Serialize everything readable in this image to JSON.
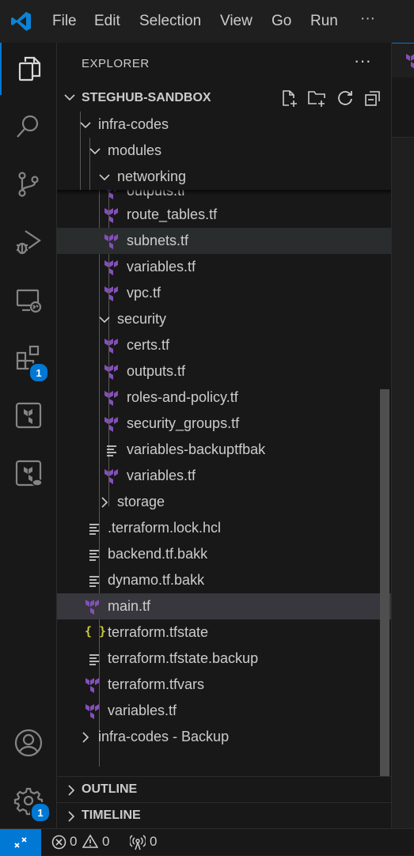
{
  "menu": {
    "file": "File",
    "edit": "Edit",
    "selection": "Selection",
    "view": "View",
    "go": "Go",
    "run": "Run",
    "more": "···"
  },
  "activity_bar": {
    "extensions_badge": "1",
    "accounts_badge": "1"
  },
  "explorer": {
    "title": "EXPLORER",
    "more": "···",
    "root": "STEGHUB-SANDBOX",
    "sticky": {
      "infra_codes": "infra-codes",
      "modules": "modules",
      "networking": "networking"
    },
    "files": {
      "outputs_partial": "outputs.tf",
      "route_tables": "route_tables.tf",
      "subnets": "subnets.tf",
      "variables_net": "variables.tf",
      "vpc": "vpc.tf",
      "security": "security",
      "certs": "certs.tf",
      "outputs_sec": "outputs.tf",
      "roles_policy": "roles-and-policy.tf",
      "security_groups": "security_groups.tf",
      "variables_backup": "variables-backuptfbak",
      "variables_sec": "variables.tf",
      "storage": "storage",
      "lock_hcl": ".terraform.lock.hcl",
      "backend_bakk": "backend.tf.bakk",
      "dynamo_bakk": "dynamo.tf.bakk",
      "main": "main.tf",
      "tfstate": "terraform.tfstate",
      "tfstate_backup": "terraform.tfstate.backup",
      "tfvars": "terraform.tfvars",
      "variables_root": "variables.tf",
      "infra_backup": "infra-codes - Backup"
    },
    "json_icon_glyph": "{ }"
  },
  "panels": {
    "outline": "OUTLINE",
    "timeline": "TIMELINE"
  },
  "status": {
    "errors": "0",
    "warnings": "0",
    "ports": "0"
  },
  "colors": {
    "accent": "#0078d4",
    "terraform": "#844fba",
    "json": "#cbcb41"
  }
}
